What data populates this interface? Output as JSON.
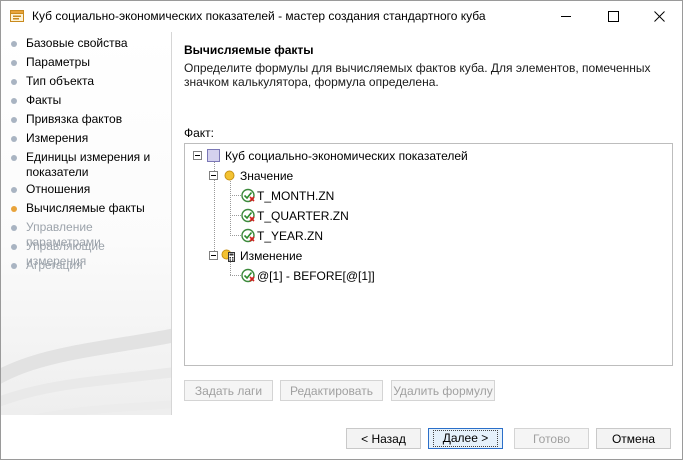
{
  "window": {
    "title": "Куб социально-экономических показателей - мастер создания стандартного куба"
  },
  "steps": [
    {
      "label": "Базовые свойства",
      "state": "done"
    },
    {
      "label": "Параметры",
      "state": "done"
    },
    {
      "label": "Тип объекта",
      "state": "done"
    },
    {
      "label": "Факты",
      "state": "done"
    },
    {
      "label": "Привязка фактов",
      "state": "done"
    },
    {
      "label": "Измерения",
      "state": "done"
    },
    {
      "label": "Единицы измерения и показатели",
      "state": "done"
    },
    {
      "label": "Отношения",
      "state": "done"
    },
    {
      "label": "Вычисляемые факты",
      "state": "active"
    },
    {
      "label": "Управление параметрами",
      "state": "disabled"
    },
    {
      "label": "Управляющие измерения",
      "state": "disabled"
    },
    {
      "label": "Агрегация",
      "state": "disabled"
    }
  ],
  "page": {
    "title": "Вычисляемые факты",
    "description": "Определите формулы для вычисляемых фактов куба. Для элементов, помеченных значком калькулятора, формула определена.",
    "fact_label": "Факт:"
  },
  "tree": {
    "root": "Куб социально-экономических показателей",
    "group1": "Значение",
    "group1_items": [
      "T_MONTH.ZN",
      "T_QUARTER.ZN",
      "T_YEAR.ZN"
    ],
    "group2": "Изменение",
    "group2_items": [
      "@[1] - BEFORE[@[1]]"
    ]
  },
  "actions": {
    "set_lags": "Задать лаги",
    "edit": "Редактировать",
    "delete_formula": "Удалить формулу"
  },
  "nav": {
    "back": "< Назад",
    "next": "Далее >",
    "finish": "Готово",
    "cancel": "Отмена"
  },
  "colors": {
    "active_step_dot": "#e8a33b",
    "step_dot": "#a9b4c2",
    "disabled_text": "#9ca3ab",
    "primary_button_border": "#2b6fc9"
  }
}
